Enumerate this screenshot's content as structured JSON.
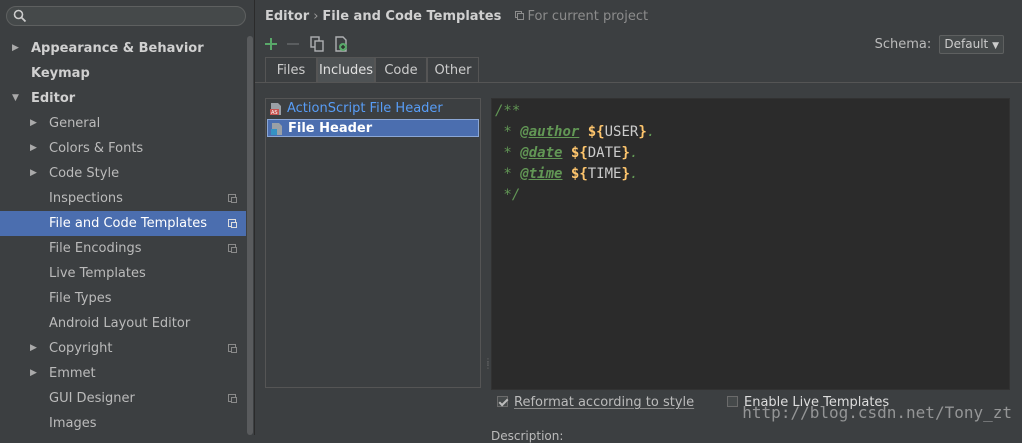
{
  "search": {
    "placeholder": ""
  },
  "sidebar": {
    "items": [
      {
        "label": "Appearance & Behavior",
        "level": 0,
        "arrow": "▶",
        "bold": true
      },
      {
        "label": "Keymap",
        "level": 0,
        "arrow": "",
        "bold": true
      },
      {
        "label": "Editor",
        "level": 0,
        "arrow": "▼",
        "bold": true
      },
      {
        "label": "General",
        "level": 1,
        "arrow": "▶"
      },
      {
        "label": "Colors & Fonts",
        "level": 1,
        "arrow": "▶"
      },
      {
        "label": "Code Style",
        "level": 1,
        "arrow": "▶"
      },
      {
        "label": "Inspections",
        "level": 1,
        "arrow": "",
        "project": true
      },
      {
        "label": "File and Code Templates",
        "level": 1,
        "arrow": "",
        "project": true,
        "selected": true
      },
      {
        "label": "File Encodings",
        "level": 1,
        "arrow": "",
        "project": true
      },
      {
        "label": "Live Templates",
        "level": 1,
        "arrow": ""
      },
      {
        "label": "File Types",
        "level": 1,
        "arrow": ""
      },
      {
        "label": "Android Layout Editor",
        "level": 1,
        "arrow": ""
      },
      {
        "label": "Copyright",
        "level": 1,
        "arrow": "▶",
        "project": true
      },
      {
        "label": "Emmet",
        "level": 1,
        "arrow": "▶"
      },
      {
        "label": "GUI Designer",
        "level": 1,
        "arrow": "",
        "project": true
      },
      {
        "label": "Images",
        "level": 1,
        "arrow": ""
      }
    ]
  },
  "header": {
    "crumb_parent": "Editor",
    "crumb_sep": "›",
    "crumb_current": "File and Code Templates",
    "project_note": "For current project"
  },
  "toolbar": {
    "icons": [
      "add-icon",
      "remove-icon",
      "copy-icon",
      "reset-icon"
    ]
  },
  "schema": {
    "label": "Schema:",
    "value": "Default"
  },
  "tabs": [
    {
      "label": "Files"
    },
    {
      "label": "Includes",
      "active": true
    },
    {
      "label": "Code"
    },
    {
      "label": "Other"
    }
  ],
  "templates": [
    {
      "label": "ActionScript File Header",
      "link": true
    },
    {
      "label": "File Header",
      "selected": true
    }
  ],
  "editor": {
    "lines": [
      {
        "pre": "/**"
      },
      {
        "pre": " * ",
        "tag": "@author",
        "sp": " ",
        "dollar": "${",
        "var": "USER",
        "close": "}",
        "post": "."
      },
      {
        "pre": " * ",
        "tag": "@date",
        "sp": " ",
        "dollar": "${",
        "var": "DATE",
        "close": "}",
        "post": "."
      },
      {
        "pre": " * ",
        "tag": "@time",
        "sp": " ",
        "dollar": "${",
        "var": "TIME",
        "close": "}",
        "post": "."
      },
      {
        "pre": " */"
      }
    ]
  },
  "options": {
    "reformat": {
      "label": "Reformat according to style",
      "checked": true
    },
    "live": {
      "label": "Enable Live Templates",
      "checked": false
    }
  },
  "description_label": "Description:",
  "watermark": "http://blog.csdn.net/Tony_zt",
  "colors": {
    "background": "#3c3f41",
    "selection": "#4b6eaf",
    "link": "#589df6",
    "editor_bg": "#2b2b2b",
    "comment": "#629755",
    "template_var": "#ffc66d"
  }
}
